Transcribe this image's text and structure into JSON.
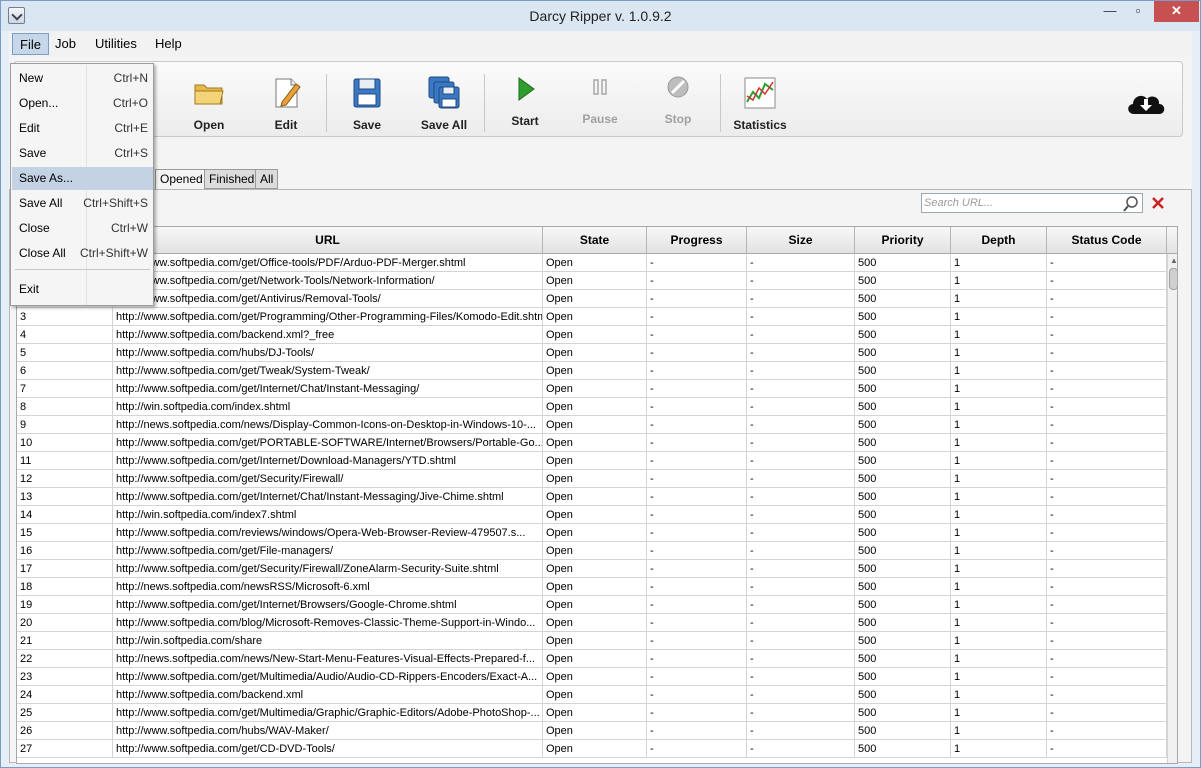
{
  "window": {
    "title": "Darcy Ripper v. 1.0.9.2",
    "minimize": "—",
    "maximize": "▫",
    "close": "✕"
  },
  "menubar": {
    "file": "File",
    "job": "Job",
    "utilities": "Utilities",
    "help": "Help"
  },
  "file_menu": {
    "items": [
      {
        "label": "New",
        "shortcut": "Ctrl+N"
      },
      {
        "label": "Open...",
        "shortcut": "Ctrl+O"
      },
      {
        "label": "Edit",
        "shortcut": "Ctrl+E"
      },
      {
        "label": "Save",
        "shortcut": "Ctrl+S"
      },
      {
        "label": "Save As...",
        "shortcut": ""
      },
      {
        "label": "Save All",
        "shortcut": "Ctrl+Shift+S"
      },
      {
        "label": "Close",
        "shortcut": "Ctrl+W"
      },
      {
        "label": "Close All",
        "shortcut": "Ctrl+Shift+W"
      },
      {
        "label": "Exit",
        "shortcut": ""
      }
    ],
    "highlighted": "Save As..."
  },
  "toolbar": {
    "open": "Open",
    "edit": "Edit",
    "save": "Save",
    "save_all": "Save All",
    "start": "Start",
    "pause": "Pause",
    "stop": "Stop",
    "statistics": "Statistics"
  },
  "tabs": {
    "opened": "Opened",
    "finished": "Finished",
    "all": "All"
  },
  "search": {
    "placeholder": "Search URL..."
  },
  "table": {
    "headers": {
      "index": "",
      "url": "URL",
      "state": "State",
      "progress": "Progress",
      "size": "Size",
      "priority": "Priority",
      "depth": "Depth",
      "status_code": "Status Code"
    },
    "rows": [
      {
        "n": "",
        "url": "http://www.softpedia.com/get/Office-tools/PDF/Arduo-PDF-Merger.shtml"
      },
      {
        "n": "",
        "url": "http://www.softpedia.com/get/Network-Tools/Network-Information/"
      },
      {
        "n": "",
        "url": "http://www.softpedia.com/get/Antivirus/Removal-Tools/"
      },
      {
        "n": "3",
        "url": "http://www.softpedia.com/get/Programming/Other-Programming-Files/Komodo-Edit.shtml"
      },
      {
        "n": "4",
        "url": "http://www.softpedia.com/backend.xml?_free"
      },
      {
        "n": "5",
        "url": "http://www.softpedia.com/hubs/DJ-Tools/"
      },
      {
        "n": "6",
        "url": "http://www.softpedia.com/get/Tweak/System-Tweak/"
      },
      {
        "n": "7",
        "url": "http://www.softpedia.com/get/Internet/Chat/Instant-Messaging/"
      },
      {
        "n": "8",
        "url": "http://win.softpedia.com/index.shtml"
      },
      {
        "n": "9",
        "url": "http://news.softpedia.com/news/Display-Common-Icons-on-Desktop-in-Windows-10-..."
      },
      {
        "n": "10",
        "url": "http://www.softpedia.com/get/PORTABLE-SOFTWARE/Internet/Browsers/Portable-Go..."
      },
      {
        "n": "11",
        "url": "http://www.softpedia.com/get/Internet/Download-Managers/YTD.shtml"
      },
      {
        "n": "12",
        "url": "http://www.softpedia.com/get/Security/Firewall/"
      },
      {
        "n": "13",
        "url": "http://www.softpedia.com/get/Internet/Chat/Instant-Messaging/Jive-Chime.shtml"
      },
      {
        "n": "14",
        "url": "http://win.softpedia.com/index7.shtml"
      },
      {
        "n": "15",
        "url": "http://www.softpedia.com/reviews/windows/Opera-Web-Browser-Review-479507.s..."
      },
      {
        "n": "16",
        "url": "http://www.softpedia.com/get/File-managers/"
      },
      {
        "n": "17",
        "url": "http://www.softpedia.com/get/Security/Firewall/ZoneAlarm-Security-Suite.shtml"
      },
      {
        "n": "18",
        "url": "http://news.softpedia.com/newsRSS/Microsoft-6.xml"
      },
      {
        "n": "19",
        "url": "http://www.softpedia.com/get/Internet/Browsers/Google-Chrome.shtml"
      },
      {
        "n": "20",
        "url": "http://www.softpedia.com/blog/Microsoft-Removes-Classic-Theme-Support-in-Windo..."
      },
      {
        "n": "21",
        "url": "http://win.softpedia.com/share"
      },
      {
        "n": "22",
        "url": "http://news.softpedia.com/news/New-Start-Menu-Features-Visual-Effects-Prepared-f..."
      },
      {
        "n": "23",
        "url": "http://www.softpedia.com/get/Multimedia/Audio/Audio-CD-Rippers-Encoders/Exact-A..."
      },
      {
        "n": "24",
        "url": "http://www.softpedia.com/backend.xml"
      },
      {
        "n": "25",
        "url": "http://www.softpedia.com/get/Multimedia/Graphic/Graphic-Editors/Adobe-PhotoShop-..."
      },
      {
        "n": "26",
        "url": "http://www.softpedia.com/hubs/WAV-Maker/"
      },
      {
        "n": "27",
        "url": "http://www.softpedia.com/get/CD-DVD-Tools/"
      }
    ],
    "row_defaults": {
      "state": "Open",
      "progress": "-",
      "size": "-",
      "priority": "500",
      "depth": "1",
      "status_code": "-"
    }
  },
  "colors": {
    "title_bar": "#dbe6f3",
    "close_button": "#c75050",
    "menu_highlight": "#c4d3e4",
    "start_green": "#2e9e2e",
    "clear_red": "#cc2222"
  },
  "icons": {
    "open": "folder-icon",
    "edit": "pencil-document-icon",
    "save": "floppy-disk-icon",
    "save_all": "multiple-floppy-icon",
    "start": "play-icon",
    "pause": "pause-icon",
    "stop": "stop-icon",
    "statistics": "chart-icon",
    "cloud": "cloud-download-icon",
    "search": "search-icon",
    "clear": "close-icon"
  }
}
